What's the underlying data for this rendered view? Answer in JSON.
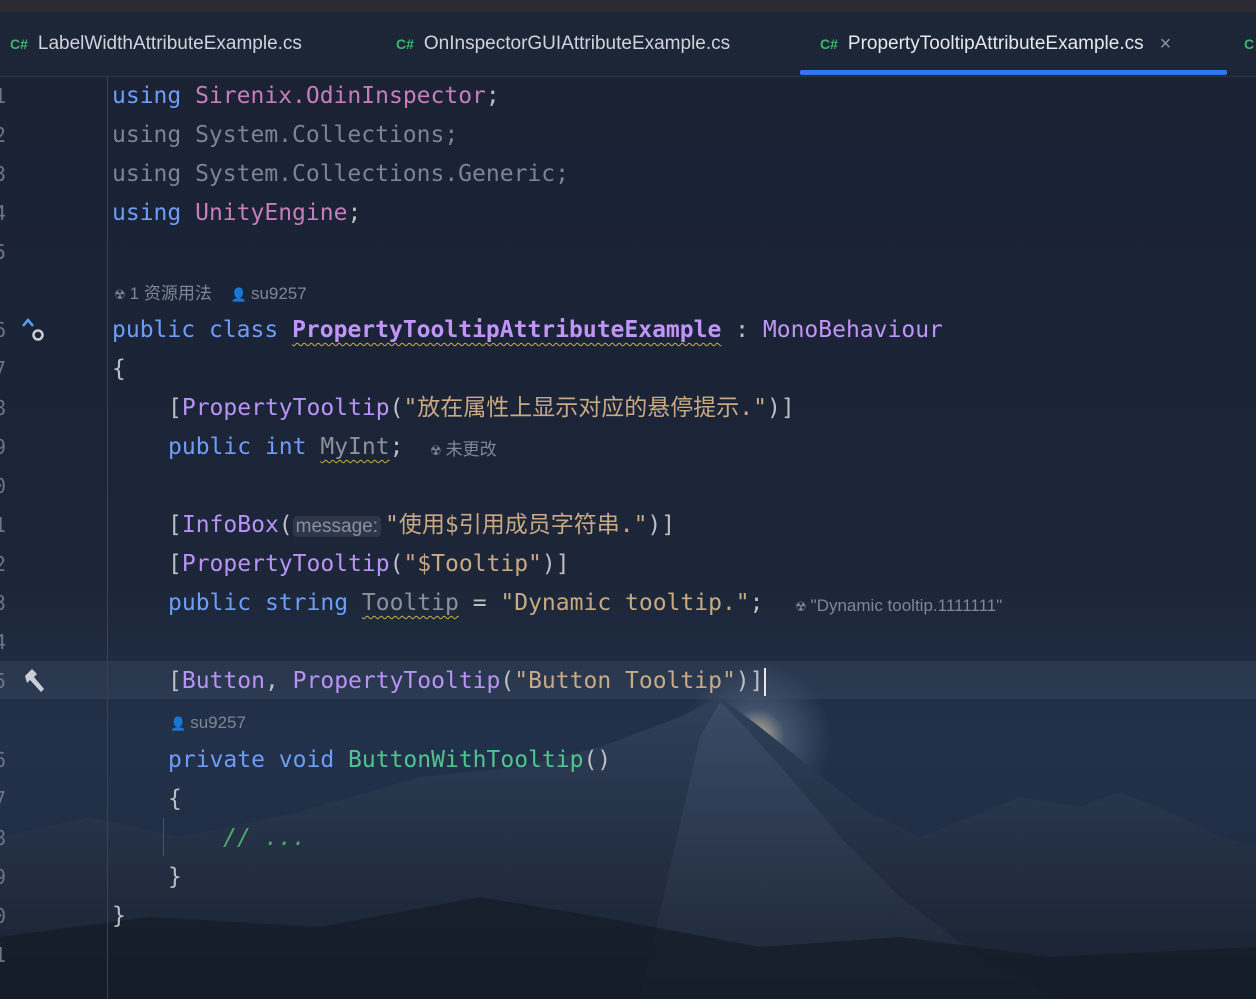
{
  "tabs": [
    {
      "badge": "C#",
      "label": "LabelWidthAttributeExample.cs"
    },
    {
      "badge": "C#",
      "label": "OnInspectorGUIAttributeExample.cs"
    },
    {
      "badge": "C#",
      "label": "PropertyTooltipAttributeExample.cs",
      "active": true,
      "close": "×"
    },
    {
      "badge": "C"
    }
  ],
  "gutter": {
    "lines": [
      "1",
      "2",
      "3",
      "4",
      "5",
      "6",
      "7",
      "8",
      "9",
      "0",
      "1",
      "2",
      "3",
      "4",
      "5",
      "6",
      "7",
      "8",
      "9",
      "0",
      "1"
    ],
    "icons": [
      "override-marker-icon",
      "hammer-icon"
    ]
  },
  "hints": {
    "usages": "1 资源用法",
    "author1": "su9257",
    "unchanged": "未更改",
    "tooltip_value": "\"Dynamic tooltip.1111111\"",
    "author2": "su9257",
    "param_message": "message:"
  },
  "code": {
    "l1": {
      "kw": "using",
      "ns": "Sirenix.OdinInspector",
      "end": ";"
    },
    "l2": "using System.Collections;",
    "l3": "using System.Collections.Generic;",
    "l4": {
      "kw": "using",
      "ns": "UnityEngine",
      "end": ";"
    },
    "l6": {
      "kw1": "public",
      "kw2": "class",
      "name": "PropertyTooltipAttributeExample",
      "sep": " : ",
      "base": "MonoBehaviour"
    },
    "l7": "{",
    "l8": {
      "open": "[",
      "attr": "PropertyTooltip",
      "p1": "(",
      "str": "\"放在属性上显示对应的悬停提示.\"",
      "close": ")]"
    },
    "l9": {
      "kw1": "public",
      "kw2": "int",
      "field": "MyInt",
      "end": ";"
    },
    "l11": {
      "open": "[",
      "attr": "InfoBox",
      "p1": "(",
      "str": "\"使用$引用成员字符串.\"",
      "close": ")]"
    },
    "l12": {
      "open": "[",
      "attr": "PropertyTooltip",
      "p1": "(",
      "str": "\"$Tooltip\"",
      "close": ")]"
    },
    "l13": {
      "kw1": "public",
      "kw2": "string",
      "field": "Tooltip",
      "eq": " = ",
      "str": "\"Dynamic tooltip.\"",
      "end": ";"
    },
    "l15": {
      "open": "[",
      "attr1": "Button",
      "comma": ", ",
      "attr2": "PropertyTooltip",
      "p1": "(",
      "str": "\"Button Tooltip\"",
      "close": ")]"
    },
    "l16": {
      "kw1": "private",
      "kw2": "void",
      "method": "ButtonWithTooltip",
      "parens": "()"
    },
    "l17": "{",
    "l18": "// ...",
    "l19": "}",
    "l20": "}"
  }
}
